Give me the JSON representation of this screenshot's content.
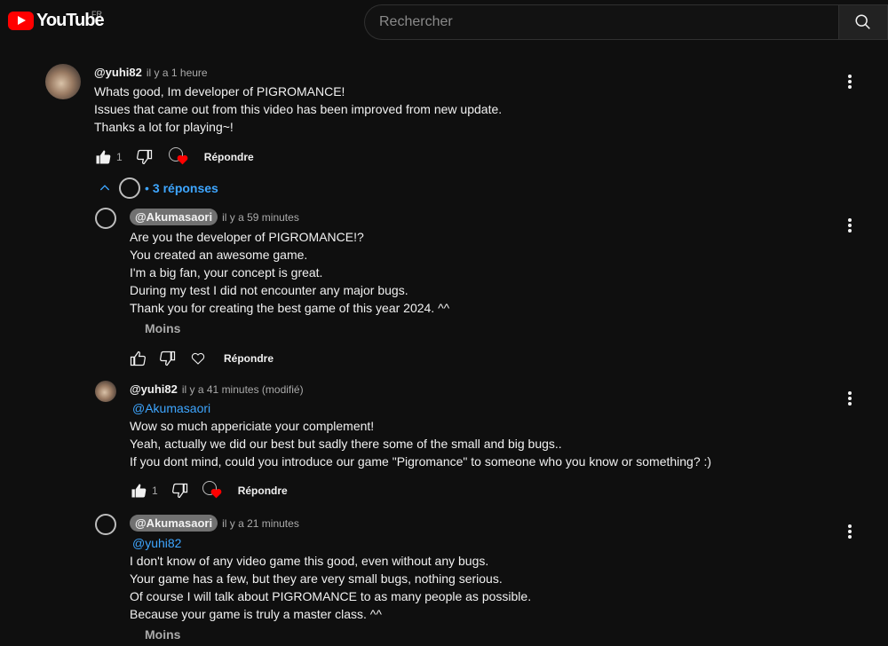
{
  "header": {
    "logo_text": "YouTube",
    "region": "FR",
    "search_placeholder": "Rechercher"
  },
  "colors": {
    "background": "#0f0f0f",
    "link": "#3ea6ff",
    "brand_red": "#ff0000"
  },
  "comment": {
    "author": "@yuhi82",
    "time": "il y a 1 heure",
    "lines": [
      "Whats good, Im developer of PIGROMANCE!",
      "Issues that came out from this video has been improved from new update.",
      "Thanks a lot for playing~!"
    ],
    "likes": "1",
    "reply_label": "Répondre",
    "replies_toggle": "3 réponses"
  },
  "replies": [
    {
      "author": "@Akumasaori",
      "time": "il y a 59 minutes",
      "lines": [
        "Are you the developer of PIGROMANCE!?",
        "You created an awesome game.",
        "I'm a big fan, your concept is great.",
        "During my test I did not encounter any major bugs.",
        "Thank you for creating the best game of this year 2024. ^^"
      ],
      "less_label": "Moins",
      "reply_label": "Répondre"
    },
    {
      "author": "@yuhi82",
      "time": "il y a 41 minutes (modifié)",
      "mention": "@Akumasaori",
      "lines": [
        "Wow so much appericiate your complement!",
        "Yeah, actually we did our best but sadly there some of the small and big bugs..",
        "If you dont mind, could you introduce our game \"Pigromance\" to someone who you know or something? :)"
      ],
      "likes": "1",
      "reply_label": "Répondre"
    },
    {
      "author": "@Akumasaori",
      "time": "il y a 21 minutes",
      "mention": "@yuhi82",
      "lines": [
        "I don't know of any video game this good, even without any bugs.",
        "Your game has a few, but they are very small bugs, nothing serious.",
        "Of course I will talk about PIGROMANCE to as many people as possible.",
        "Because your game is truly a master class. ^^"
      ],
      "less_label": "Moins"
    }
  ]
}
